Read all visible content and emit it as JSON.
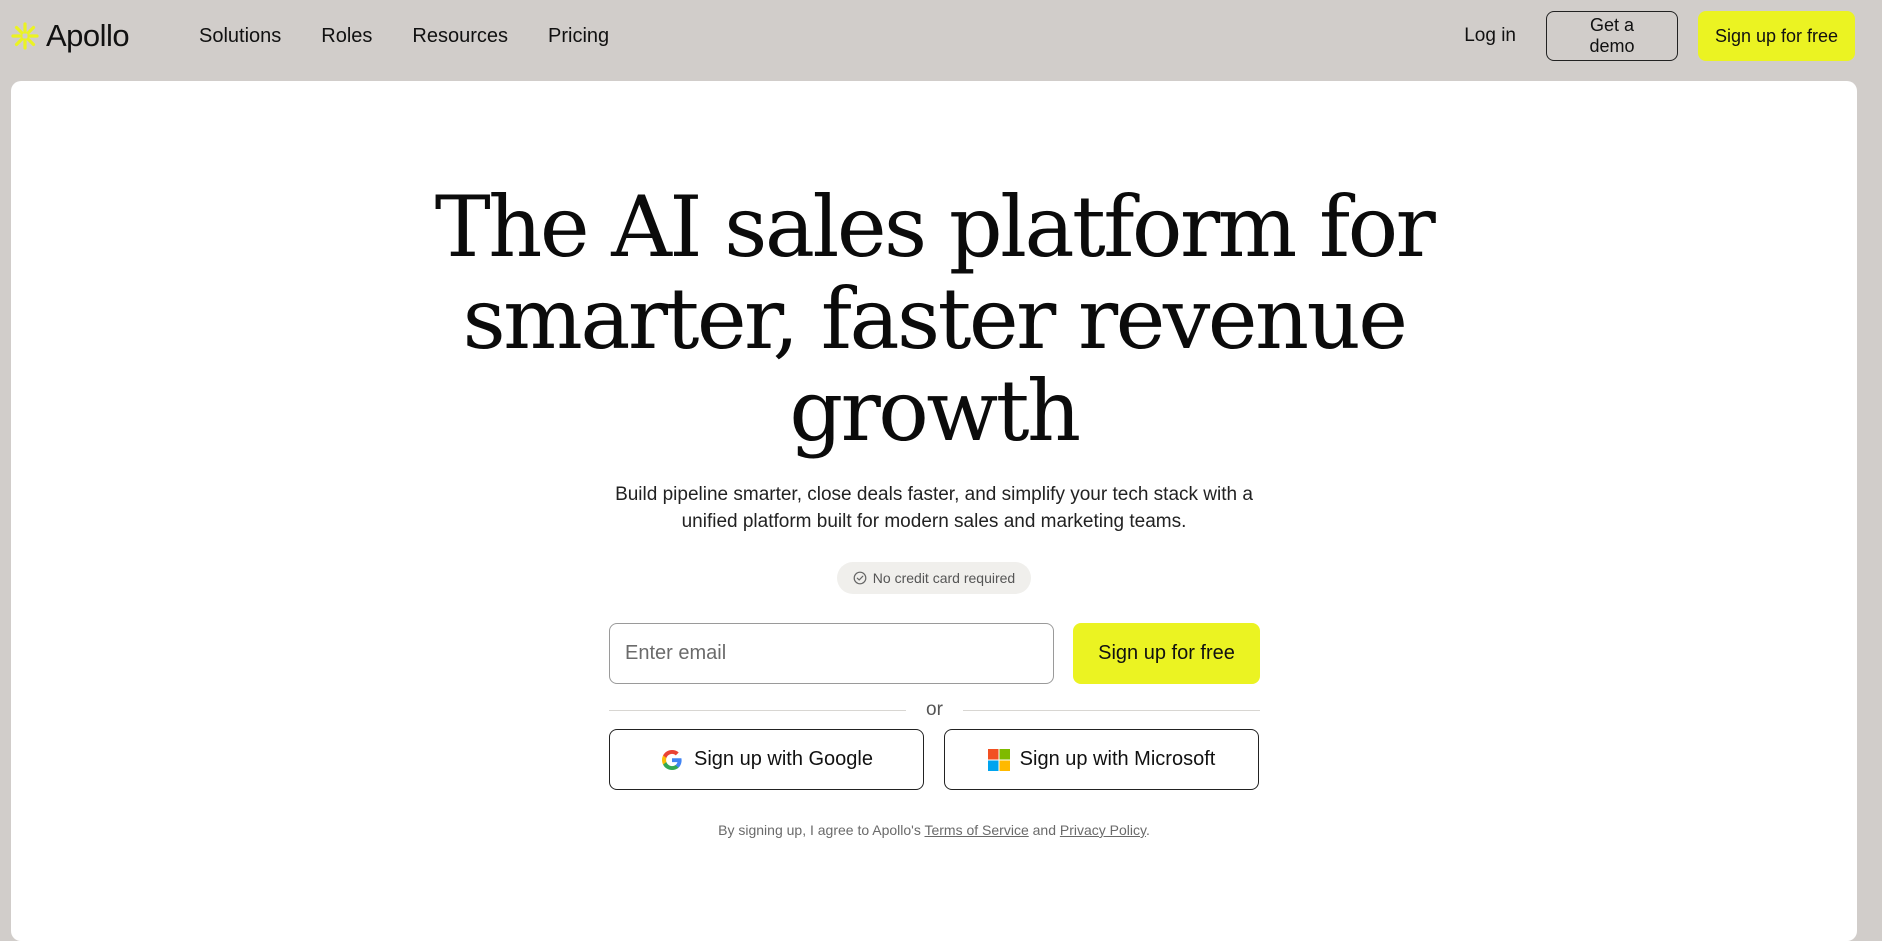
{
  "brand": {
    "name": "Apollo",
    "accent_color": "#ebf322",
    "logo_icon": "sunburst-icon"
  },
  "nav": {
    "items": [
      {
        "label": "Solutions"
      },
      {
        "label": "Roles"
      },
      {
        "label": "Resources"
      },
      {
        "label": "Pricing"
      }
    ]
  },
  "header_actions": {
    "login": "Log in",
    "demo": "Get a demo",
    "signup": "Sign up for free"
  },
  "hero": {
    "headline_lines": [
      "The AI sales platform for",
      "smarter, faster revenue",
      "growth"
    ],
    "subtext": "Build pipeline smarter, close deals faster, and simplify your tech stack with a unified platform built for modern sales and marketing teams.",
    "badge": "No credit card required",
    "email_placeholder": "Enter email",
    "email_value": "",
    "signup_button": "Sign up for free",
    "divider_text": "or",
    "google_button": "Sign up with Google",
    "microsoft_button": "Sign up with Microsoft"
  },
  "legal": {
    "prefix": "By signing up, I agree to Apollo's",
    "terms": "Terms of Service",
    "conjunction": "and",
    "privacy": "Privacy Policy",
    "suffix": "."
  }
}
